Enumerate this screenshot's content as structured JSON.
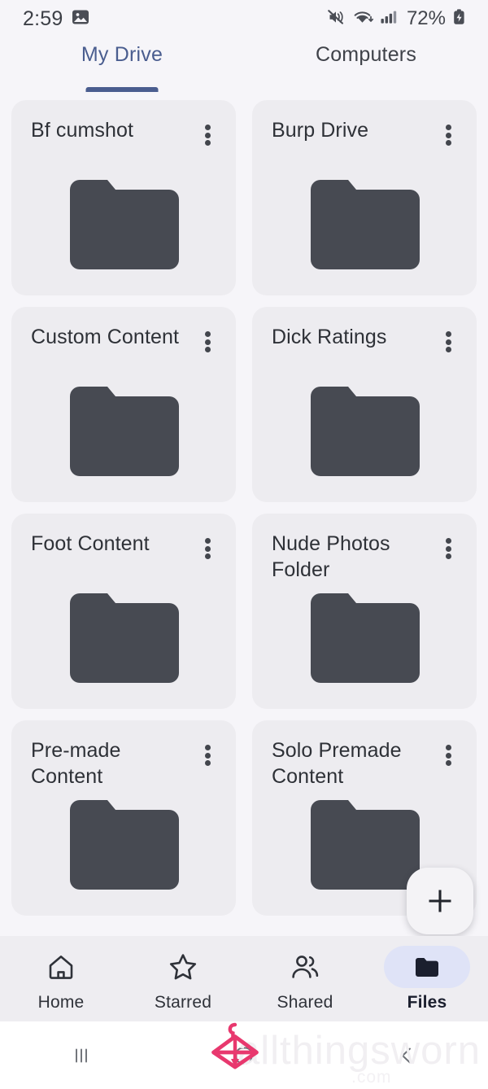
{
  "status_bar": {
    "time": "2:59",
    "battery_percent": "72%",
    "icons": [
      "image-icon",
      "mute-icon",
      "wifi-icon",
      "signal-icon",
      "battery-charging-icon"
    ]
  },
  "tabs": [
    {
      "label": "My Drive",
      "active": true
    },
    {
      "label": "Computers",
      "active": false
    }
  ],
  "colors": {
    "page_background": "#f6f5f9",
    "card_background": "#edecf0",
    "folder_fill": "#474a52",
    "tab_accent": "#4a5d8f",
    "active_nav_pill": "#dfe3f7",
    "active_nav_icon": "#1b1f2e",
    "watermark_pink": "#e8386e"
  },
  "files": [
    {
      "name": "Bf cumshot",
      "type": "folder"
    },
    {
      "name": "Burp Drive",
      "type": "folder"
    },
    {
      "name": "Custom Content",
      "type": "folder"
    },
    {
      "name": "Dick Ratings",
      "type": "folder"
    },
    {
      "name": "Foot Content",
      "type": "folder"
    },
    {
      "name": "Nude Photos Folder",
      "type": "folder"
    },
    {
      "name": "Pre-made Content",
      "type": "folder"
    },
    {
      "name": "Solo Premade Content",
      "type": "folder"
    }
  ],
  "fab": {
    "label": "+",
    "icon": "plus-icon"
  },
  "bottom_nav": [
    {
      "label": "Home",
      "icon": "home-icon",
      "active": false
    },
    {
      "label": "Starred",
      "icon": "star-icon",
      "active": false
    },
    {
      "label": "Shared",
      "icon": "people-icon",
      "active": false
    },
    {
      "label": "Files",
      "icon": "folder-icon",
      "active": true
    }
  ],
  "system_nav": [
    {
      "icon": "recents-icon"
    },
    {
      "icon": "home-circle-icon"
    },
    {
      "icon": "back-icon"
    }
  ],
  "watermark": {
    "text": "allthingsworn",
    "suffix": ".com",
    "logo": "hanger-logo"
  }
}
